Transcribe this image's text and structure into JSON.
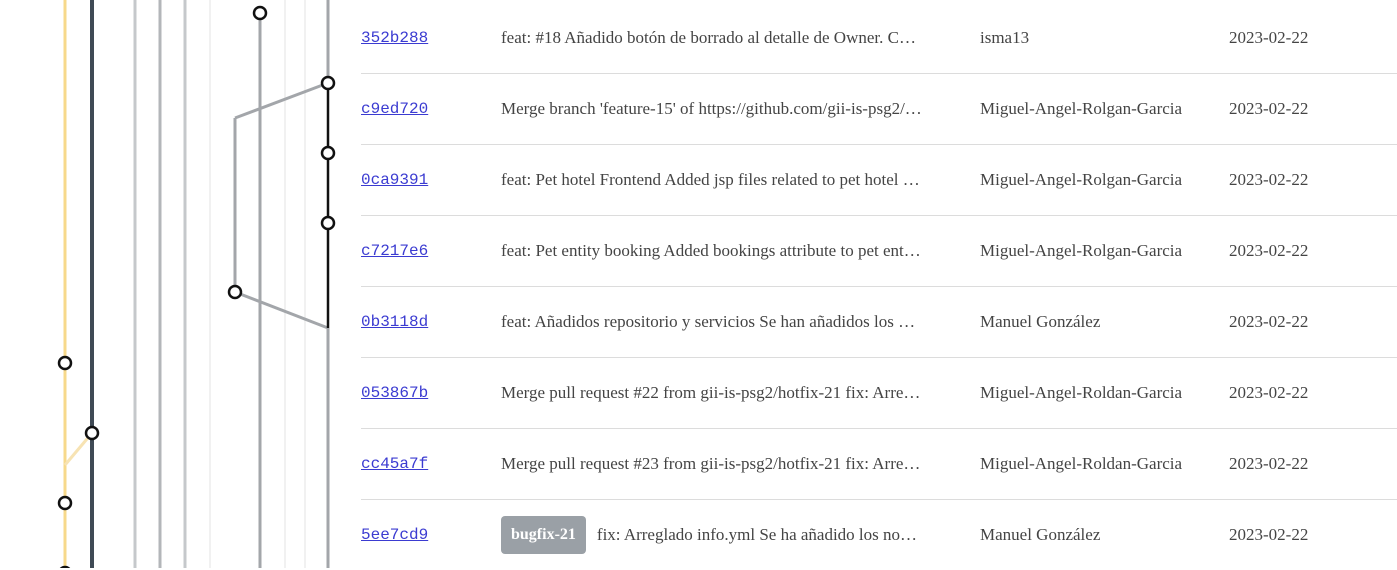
{
  "commits": [
    {
      "hash": "352b288",
      "message": "feat: #18 Añadido botón de borrado al detalle de Owner. C…",
      "author": "isma13",
      "date": "2023-02-22"
    },
    {
      "hash": "c9ed720",
      "message": "Merge branch 'feature-15' of https://github.com/gii-is-psg2/…",
      "author": "Miguel-Angel-Rolgan-Garcia",
      "date": "2023-02-22"
    },
    {
      "hash": "0ca9391",
      "message": "feat: Pet hotel Frontend Added jsp files related to pet hotel …",
      "author": "Miguel-Angel-Rolgan-Garcia",
      "date": "2023-02-22"
    },
    {
      "hash": "c7217e6",
      "message": "feat: Pet entity booking Added bookings attribute to pet ent…",
      "author": "Miguel-Angel-Rolgan-Garcia",
      "date": "2023-02-22"
    },
    {
      "hash": "0b3118d",
      "message": "feat: Añadidos repositorio y servicios Se han añadidos los …",
      "author": "Manuel González",
      "date": "2023-02-22"
    },
    {
      "hash": "053867b",
      "message": "Merge pull request #22 from gii-is-psg2/hotfix-21 fix: Arre…",
      "author": "Miguel-Angel-Roldan-Garcia",
      "date": "2023-02-22"
    },
    {
      "hash": "cc45a7f",
      "message": "Merge pull request #23 from gii-is-psg2/hotfix-21 fix: Arre…",
      "author": "Miguel-Angel-Roldan-Garcia",
      "date": "2023-02-22"
    },
    {
      "hash": "5ee7cd9",
      "badge": "bugfix-21",
      "message": "fix: Arreglado info.yml Se ha añadido los no…",
      "author": "Manuel González",
      "date": "2023-02-22"
    }
  ],
  "colors": {
    "hash_link": "#3b3bd1",
    "badge_bg": "#9aa0a6",
    "lane_yellow": "#f7d98b",
    "lane_dark": "#3f4a55",
    "lane_gray": "#a3a6aa",
    "lane_black": "#111111"
  }
}
